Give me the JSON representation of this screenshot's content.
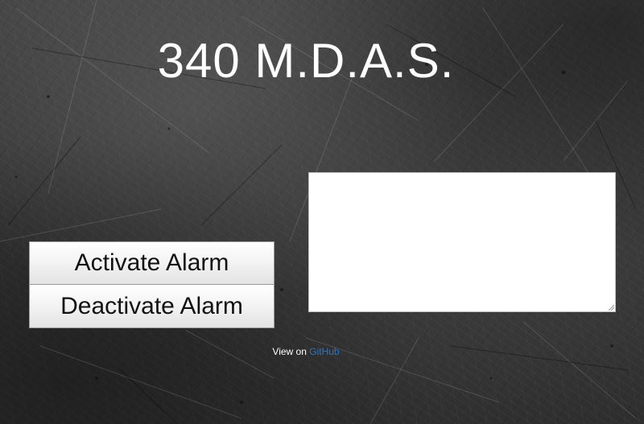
{
  "header": {
    "title": "340 M.D.A.S."
  },
  "controls": {
    "activate_label": "Activate Alarm",
    "deactivate_label": "Deactivate Alarm"
  },
  "display": {
    "content": ""
  },
  "footer": {
    "prefix": "View on",
    "link_text": "GitHub"
  },
  "colors": {
    "title_text": "#ffffff",
    "button_text": "#111111",
    "link": "#2d73c4",
    "panel": "#ffffff"
  }
}
